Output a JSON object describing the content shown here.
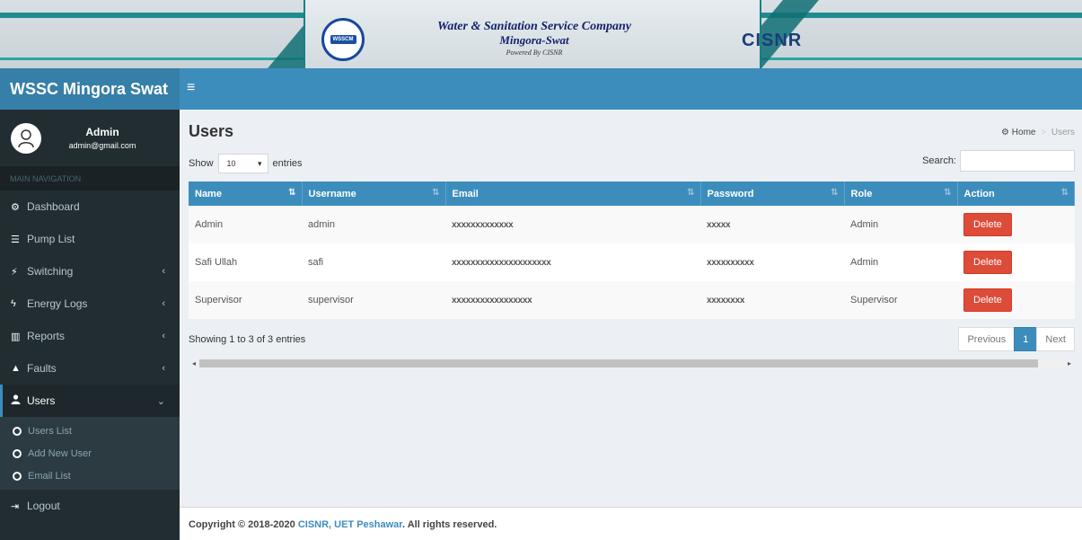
{
  "banner": {
    "logo_text": "WSSCM",
    "title_line1": "Water & Sanitation Service Company",
    "title_line2": "Mingora-Swat",
    "title_line3": "Powered By CISNR",
    "partner_logo_text": "CISNR"
  },
  "brand": {
    "name": "WSSC Mingora Swat"
  },
  "topbar": {
    "menu_icon": "≡"
  },
  "user": {
    "name": "Admin",
    "email": "admin@gmail.com"
  },
  "sidebar": {
    "header": "MAIN NAVIGATION",
    "items": [
      {
        "label": "Dashboard",
        "icon": "dashboard-icon",
        "glyph": "⚙"
      },
      {
        "label": "Pump List",
        "icon": "list-icon",
        "glyph": "☰"
      },
      {
        "label": "Switching",
        "icon": "plug-icon",
        "glyph": "⚡",
        "chevron": "‹"
      },
      {
        "label": "Energy Logs",
        "icon": "bolt-icon",
        "glyph": "ϟ",
        "chevron": "‹"
      },
      {
        "label": "Reports",
        "icon": "bar-chart-icon",
        "glyph": "▥",
        "chevron": "‹"
      },
      {
        "label": "Faults",
        "icon": "warning-icon",
        "glyph": "▲",
        "chevron": "‹"
      },
      {
        "label": "Users",
        "icon": "user-icon",
        "glyph": "👤",
        "chevron": "⌄"
      }
    ],
    "submenu": [
      "Users List",
      "Add New User",
      "Email List"
    ],
    "logout": {
      "label": "Logout",
      "glyph": "⇥"
    }
  },
  "page": {
    "title": "Users",
    "breadcrumb": {
      "home": "Home",
      "sep": ">",
      "current": "Users"
    }
  },
  "table_controls": {
    "show_label": "Show",
    "entries_value": "10",
    "entries_label": "entries",
    "search_label": "Search:",
    "search_value": ""
  },
  "table": {
    "columns": [
      "Name",
      "Username",
      "Email",
      "Password",
      "Role",
      "Action"
    ],
    "rows": [
      {
        "name": "Admin",
        "username": "admin",
        "email": "xxxxxxxxxxxxx",
        "password": "xxxxx",
        "role": "Admin",
        "action": "Delete"
      },
      {
        "name": "Safi Ullah",
        "username": "safi",
        "email": "xxxxxxxxxxxxxxxxxxxxx",
        "password": "xxxxxxxxxx",
        "role": "Admin",
        "action": "Delete"
      },
      {
        "name": "Supervisor",
        "username": "supervisor",
        "email": "xxxxxxxxxxxxxxxxx",
        "password": "xxxxxxxx",
        "role": "Supervisor",
        "action": "Delete"
      }
    ]
  },
  "pagination": {
    "info": "Showing 1 to 3 of 3 entries",
    "previous": "Previous",
    "current": "1",
    "next": "Next"
  },
  "footer": {
    "prefix": "Copyright © 2018-2020 ",
    "link_text": "CISNR, UET Peshawar",
    "suffix": ". All rights reserved."
  }
}
